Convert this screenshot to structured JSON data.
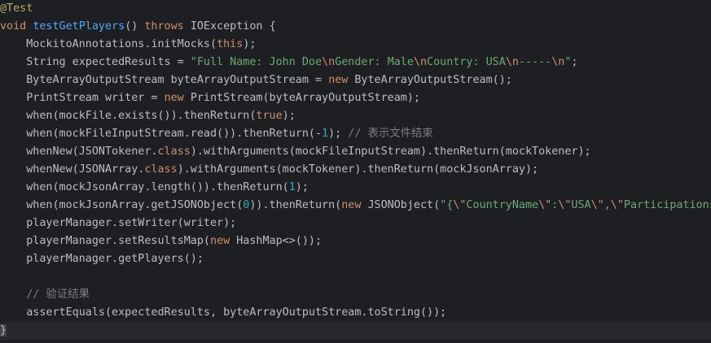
{
  "editor": {
    "lines": [
      {
        "indent": "",
        "tokens": [
          {
            "c": "ann",
            "t": "@Test"
          }
        ]
      },
      {
        "indent": "",
        "tokens": [
          {
            "c": "kw",
            "t": "void "
          },
          {
            "c": "fn",
            "t": "testGetPlayers"
          },
          {
            "c": "plain",
            "t": "() "
          },
          {
            "c": "kw",
            "t": "throws "
          },
          {
            "c": "plain",
            "t": "IOException "
          },
          {
            "c": "brace",
            "t": "{"
          }
        ]
      },
      {
        "indent": "    ",
        "tokens": [
          {
            "c": "plain",
            "t": "MockitoAnnotations."
          },
          {
            "c": "plain",
            "t": "initMocks("
          },
          {
            "c": "kw",
            "t": "this"
          },
          {
            "c": "plain",
            "t": ");"
          }
        ]
      },
      {
        "indent": "    ",
        "tokens": [
          {
            "c": "plain",
            "t": "String expectedResults = "
          },
          {
            "c": "str",
            "t": "\"Full Name: John Doe"
          },
          {
            "c": "esc",
            "t": "\\n"
          },
          {
            "c": "str",
            "t": "Gender: Male"
          },
          {
            "c": "esc",
            "t": "\\n"
          },
          {
            "c": "str",
            "t": "Country: USA"
          },
          {
            "c": "esc",
            "t": "\\n"
          },
          {
            "c": "str",
            "t": "-----"
          },
          {
            "c": "esc",
            "t": "\\n"
          },
          {
            "c": "str",
            "t": "\""
          },
          {
            "c": "plain",
            "t": ";"
          }
        ]
      },
      {
        "indent": "    ",
        "tokens": [
          {
            "c": "plain",
            "t": "ByteArrayOutputStream byteArrayOutputStream = "
          },
          {
            "c": "kw",
            "t": "new "
          },
          {
            "c": "plain",
            "t": "ByteArrayOutputStream();"
          }
        ]
      },
      {
        "indent": "    ",
        "tokens": [
          {
            "c": "plain",
            "t": "PrintStream writer = "
          },
          {
            "c": "kw",
            "t": "new "
          },
          {
            "c": "plain",
            "t": "PrintStream(byteArrayOutputStream);"
          }
        ]
      },
      {
        "indent": "    ",
        "tokens": [
          {
            "c": "plain",
            "t": "when(mockFile.exists()).thenReturn("
          },
          {
            "c": "kw",
            "t": "true"
          },
          {
            "c": "plain",
            "t": ");"
          }
        ]
      },
      {
        "indent": "    ",
        "tokens": [
          {
            "c": "plain",
            "t": "when(mockFileInputStream.read()).thenReturn(-"
          },
          {
            "c": "num",
            "t": "1"
          },
          {
            "c": "plain",
            "t": "); "
          },
          {
            "c": "cmt",
            "t": "// 表示文件结束"
          }
        ]
      },
      {
        "indent": "    ",
        "tokens": [
          {
            "c": "plain",
            "t": "whenNew(JSONTokener."
          },
          {
            "c": "kw",
            "t": "class"
          },
          {
            "c": "plain",
            "t": ").withArguments(mockFileInputStream).thenReturn(mockTokener);"
          }
        ]
      },
      {
        "indent": "    ",
        "tokens": [
          {
            "c": "plain",
            "t": "whenNew(JSONArray."
          },
          {
            "c": "kw",
            "t": "class"
          },
          {
            "c": "plain",
            "t": ").withArguments(mockTokener).thenReturn(mockJsonArray);"
          }
        ]
      },
      {
        "indent": "    ",
        "tokens": [
          {
            "c": "plain",
            "t": "when(mockJsonArray.length()).thenReturn("
          },
          {
            "c": "num",
            "t": "1"
          },
          {
            "c": "plain",
            "t": ");"
          }
        ]
      },
      {
        "indent": "    ",
        "tokens": [
          {
            "c": "plain",
            "t": "when(mockJsonArray.getJSONObject("
          },
          {
            "c": "num",
            "t": "0"
          },
          {
            "c": "plain",
            "t": ")).thenReturn("
          },
          {
            "c": "kw",
            "t": "new "
          },
          {
            "c": "plain",
            "t": "JSONObject("
          },
          {
            "c": "str",
            "t": "\"{"
          },
          {
            "c": "esc",
            "t": "\\\""
          },
          {
            "c": "str",
            "t": "CountryName"
          },
          {
            "c": "esc",
            "t": "\\\""
          },
          {
            "c": "str",
            "t": ":"
          },
          {
            "c": "esc",
            "t": "\\\""
          },
          {
            "c": "str",
            "t": "USA"
          },
          {
            "c": "esc",
            "t": "\\\""
          },
          {
            "c": "str",
            "t": ","
          },
          {
            "c": "esc",
            "t": "\\\""
          },
          {
            "c": "str",
            "t": "Participations"
          }
        ]
      },
      {
        "indent": "    ",
        "tokens": [
          {
            "c": "plain",
            "t": "playerManager.setWriter(writer);"
          }
        ]
      },
      {
        "indent": "    ",
        "tokens": [
          {
            "c": "plain",
            "t": "playerManager.setResultsMap("
          },
          {
            "c": "kw",
            "t": "new "
          },
          {
            "c": "plain",
            "t": "HashMap<>());"
          }
        ]
      },
      {
        "indent": "    ",
        "tokens": [
          {
            "c": "plain",
            "t": "playerManager.getPlayers();"
          }
        ]
      },
      {
        "indent": "",
        "tokens": []
      },
      {
        "indent": "    ",
        "tokens": [
          {
            "c": "cmt",
            "t": "// 验证结果"
          }
        ]
      },
      {
        "indent": "    ",
        "tokens": [
          {
            "c": "plain",
            "t": "assertEquals(expectedResults, byteArrayOutputStream.toString());"
          }
        ]
      },
      {
        "indent": "",
        "tokens": [
          {
            "c": "brace-hl",
            "t": "}"
          }
        ]
      }
    ]
  }
}
